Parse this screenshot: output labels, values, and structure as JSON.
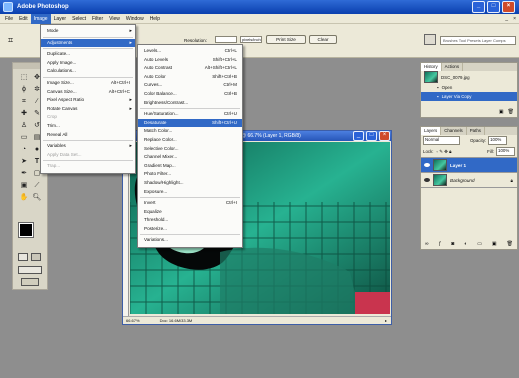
{
  "app": {
    "title": "Adobe Photoshop"
  },
  "menubar": [
    "File",
    "Edit",
    "Image",
    "Layer",
    "Select",
    "Filter",
    "View",
    "Window",
    "Help"
  ],
  "options": {
    "resolution_label": "Resolution:",
    "unit_value": "pixels/inch",
    "print_size": "Print Size",
    "clear": "Clear",
    "brushes_tab": "Brushes  Tool Presets  Layer Comps"
  },
  "image_menu": {
    "items": [
      {
        "label": "Mode",
        "sub": true
      },
      {
        "sep": true
      },
      {
        "label": "Adjustments",
        "sub": true,
        "hl": true
      },
      {
        "sep": true
      },
      {
        "label": "Duplicate..."
      },
      {
        "label": "Apply Image..."
      },
      {
        "label": "Calculations..."
      },
      {
        "sep": true
      },
      {
        "label": "Image Size...",
        "sc": "Alt+Ctrl+I"
      },
      {
        "label": "Canvas Size...",
        "sc": "Alt+Ctrl+C"
      },
      {
        "label": "Pixel Aspect Ratio",
        "sub": true
      },
      {
        "label": "Rotate Canvas",
        "sub": true
      },
      {
        "label": "Crop",
        "dis": true
      },
      {
        "label": "Trim..."
      },
      {
        "label": "Reveal All"
      },
      {
        "sep": true
      },
      {
        "label": "Variables",
        "sub": true
      },
      {
        "label": "Apply Data Set...",
        "dis": true
      },
      {
        "sep": true
      },
      {
        "label": "Trap...",
        "dis": true
      }
    ]
  },
  "adjust_menu": {
    "items": [
      {
        "label": "Levels...",
        "sc": "Ctrl+L"
      },
      {
        "label": "Auto Levels",
        "sc": "Shift+Ctrl+L"
      },
      {
        "label": "Auto Contrast",
        "sc": "Alt+Shift+Ctrl+L"
      },
      {
        "label": "Auto Color",
        "sc": "Shift+Ctrl+B"
      },
      {
        "label": "Curves...",
        "sc": "Ctrl+M"
      },
      {
        "label": "Color Balance...",
        "sc": "Ctrl+B"
      },
      {
        "label": "Brightness/Contrast..."
      },
      {
        "sep": true
      },
      {
        "label": "Hue/Saturation...",
        "sc": "Ctrl+U"
      },
      {
        "label": "Desaturate",
        "sc": "Shift+Ctrl+U",
        "hl": true
      },
      {
        "label": "Match Color..."
      },
      {
        "label": "Replace Color..."
      },
      {
        "label": "Selective Color..."
      },
      {
        "label": "Channel Mixer..."
      },
      {
        "label": "Gradient Map..."
      },
      {
        "label": "Photo Filter..."
      },
      {
        "label": "Shadow/Highlight..."
      },
      {
        "label": "Exposure..."
      },
      {
        "sep": true
      },
      {
        "label": "Invert",
        "sc": "Ctrl+I"
      },
      {
        "label": "Equalize"
      },
      {
        "label": "Threshold..."
      },
      {
        "label": "Posterize..."
      },
      {
        "sep": true
      },
      {
        "label": "Variations..."
      }
    ]
  },
  "document": {
    "title": "@ 66.7% (Layer 1, RGB/8)",
    "zoom": "66.67%",
    "status": "Doc: 16.6M/33.3M"
  },
  "history": {
    "tabs": [
      "History",
      "Actions"
    ],
    "file": "DSC_0079.jpg",
    "states": [
      "Open",
      "Layer Via Copy"
    ]
  },
  "layers": {
    "tabs": [
      "Layers",
      "Channels",
      "Paths"
    ],
    "blend_mode": "Normal",
    "opacity_label": "Opacity:",
    "opacity": "100%",
    "lock_label": "Lock:",
    "fill_label": "Fill:",
    "fill": "100%",
    "items": [
      {
        "name": "Layer 1"
      },
      {
        "name": "Background"
      }
    ]
  },
  "colors": {
    "accent": "#3169c6",
    "teal": "#1b9a7b"
  }
}
